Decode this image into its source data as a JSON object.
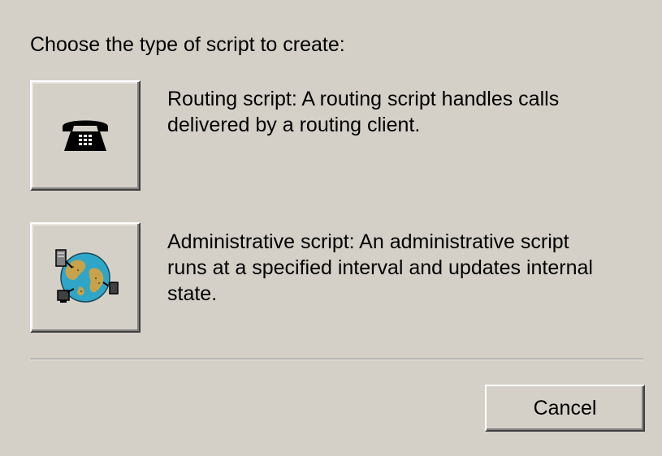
{
  "dialog": {
    "prompt": "Choose the type of script to create:",
    "options": [
      {
        "id": "routing",
        "icon": "telephone-icon",
        "description_lines": [
          "Routing script: A routing script handles calls",
          "delivered by a routing client."
        ]
      },
      {
        "id": "administrative",
        "icon": "globe-network-icon",
        "description_lines": [
          "Administrative script: An administrative script",
          "runs at a specified interval and updates internal",
          "state."
        ]
      }
    ],
    "cancel_label": "Cancel"
  },
  "colors": {
    "background": "#d4d0c8",
    "text": "#000000",
    "globe_water": "#2fa6c8",
    "globe_land": "#c8a24a",
    "phone": "#000000"
  }
}
